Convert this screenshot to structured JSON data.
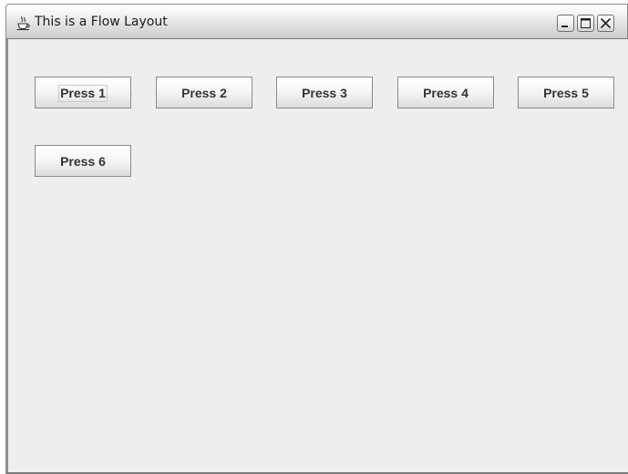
{
  "window": {
    "title": "This is a Flow Layout",
    "title_icon": "java-cup-icon",
    "controls": [
      "minimize-icon",
      "maximize-icon",
      "close-icon"
    ]
  },
  "buttons": [
    {
      "label": "Press 1",
      "focused": true
    },
    {
      "label": "Press 2",
      "focused": false
    },
    {
      "label": "Press 3",
      "focused": false
    },
    {
      "label": "Press 4",
      "focused": false
    },
    {
      "label": "Press 5",
      "focused": false
    },
    {
      "label": "Press 6",
      "focused": false
    }
  ],
  "colors": {
    "content_background": "#eeeeee",
    "button_text": "#333333",
    "focus_ring": "#b8cfe5"
  }
}
